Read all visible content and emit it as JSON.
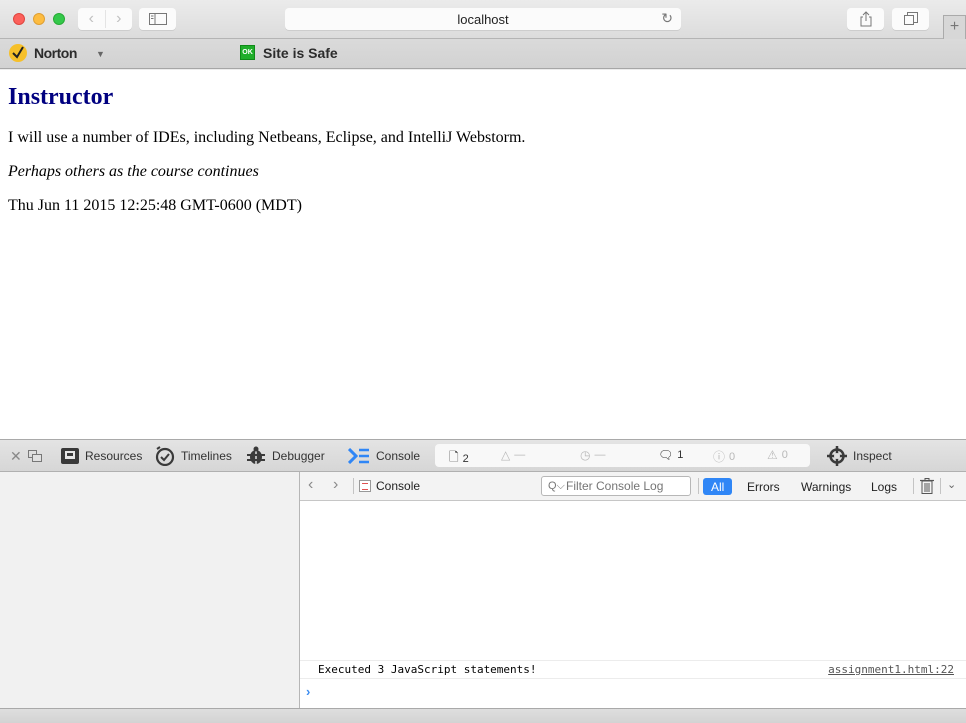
{
  "browser": {
    "url": "localhost",
    "new_tab_label": "+"
  },
  "norton": {
    "brand": "Norton",
    "ok_badge": "OK",
    "status": "Site is Safe"
  },
  "page": {
    "heading": "Instructor",
    "paragraph1": "I will use a number of IDEs, including Netbeans, Eclipse, and IntelliJ Webstorm.",
    "paragraph2": "Perhaps others as the course continues",
    "paragraph3": "Thu Jun 11 2015 12:25:48 GMT-0600 (MDT)"
  },
  "devtools": {
    "tabs": [
      {
        "label": "Resources",
        "icon": "resources-icon"
      },
      {
        "label": "Timelines",
        "icon": "timelines-icon"
      },
      {
        "label": "Debugger",
        "icon": "debugger-icon"
      },
      {
        "label": "Console",
        "icon": "console-icon",
        "active": true
      }
    ],
    "inspect_label": "Inspect",
    "counters": {
      "resources": "2",
      "network": "—",
      "load_time": "—",
      "logs": "1",
      "errors": "0",
      "warnings": "0"
    },
    "console": {
      "breadcrumb": "Console",
      "filter_placeholder": "Filter Console Log",
      "scopes": [
        "All",
        "Errors",
        "Warnings",
        "Logs"
      ],
      "active_scope": "All",
      "messages": [
        {
          "text": "Executed 3 JavaScript statements!",
          "source": "assignment1.html:22"
        }
      ],
      "prompt_glyph": "›"
    }
  },
  "colors": {
    "heading": "#000080",
    "accent": "#2f86f6",
    "norton_yellow": "#f6c02a",
    "safe_green": "#1fae2a"
  }
}
